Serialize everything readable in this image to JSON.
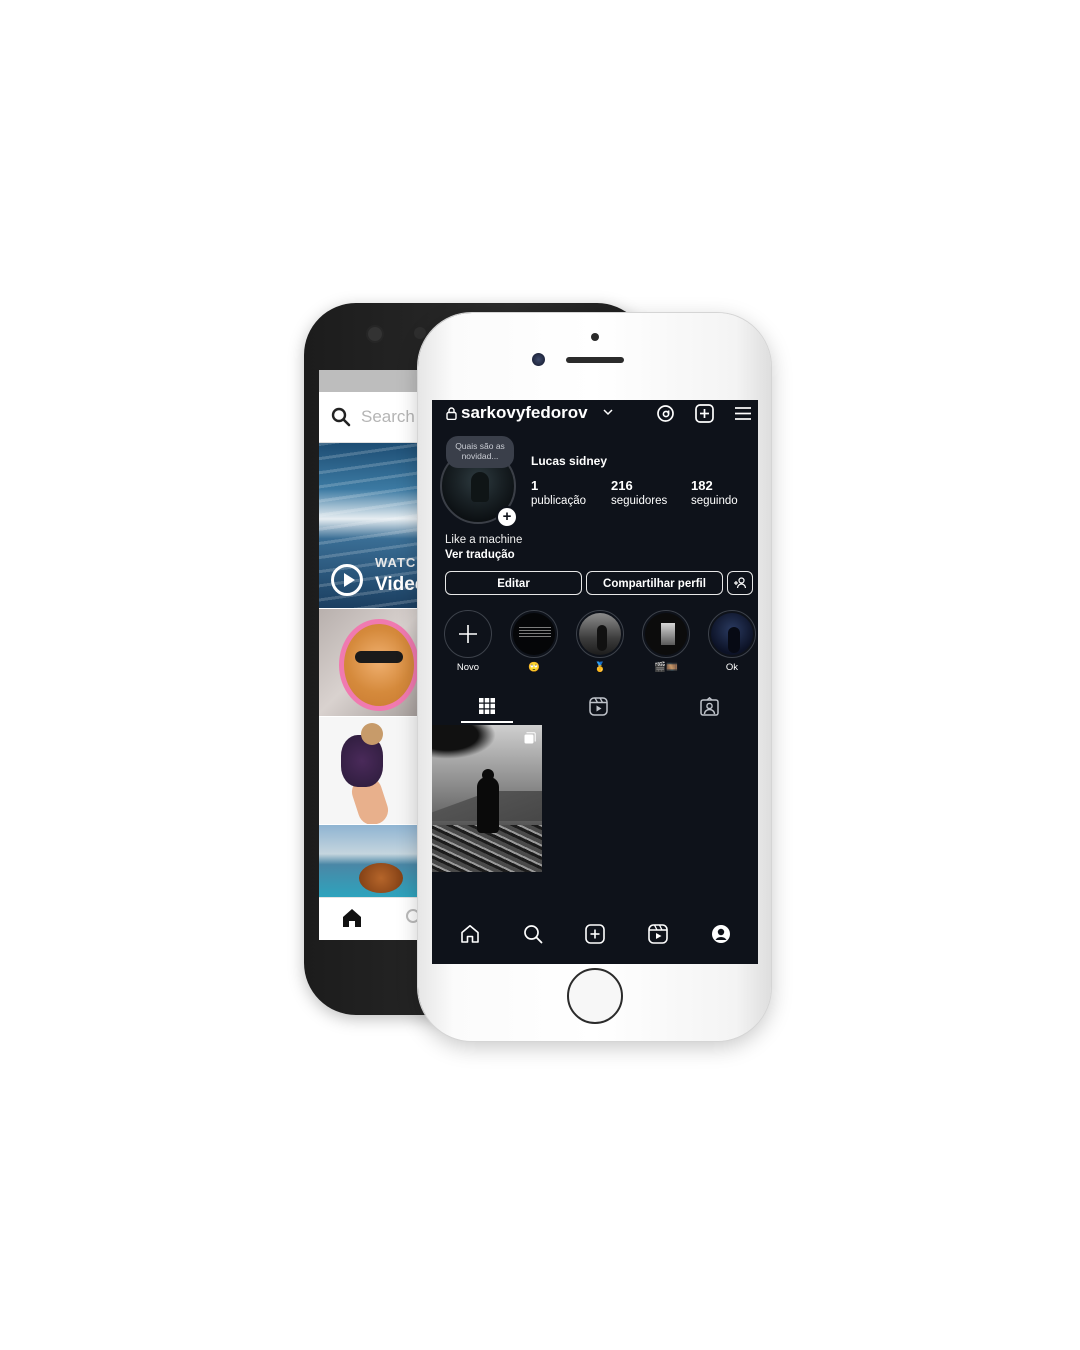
{
  "back_phone": {
    "search": {
      "placeholder": "Search"
    },
    "video_tile": {
      "label": "WATCH",
      "title": "Video"
    }
  },
  "profile": {
    "username": "sarkovyfedorov",
    "note": "Quais são as novidad...",
    "display_name": "Lucas sidney",
    "stats": [
      {
        "value": "1",
        "label": "publicação"
      },
      {
        "value": "216",
        "label": "seguidores"
      },
      {
        "value": "182",
        "label": "seguindo"
      }
    ],
    "bio": "Like a machine",
    "translate_link": "Ver tradução",
    "buttons": {
      "edit": "Editar",
      "share": "Compartilhar perfil"
    }
  },
  "highlights": [
    {
      "label": "Novo"
    },
    {
      "label": "🙄"
    },
    {
      "label": "🥇"
    },
    {
      "label": "🎬🎞️"
    },
    {
      "label": "Ok"
    }
  ],
  "icons": {
    "top": [
      "lock-icon",
      "chevron-down-icon",
      "threads-icon",
      "create-post-icon",
      "menu-icon"
    ],
    "tabs": [
      "grid-icon",
      "reels-tab-icon",
      "tagged-icon"
    ],
    "bottom_nav": [
      "home-icon",
      "search-icon",
      "create-icon",
      "reels-icon",
      "profile-icon"
    ]
  },
  "colors": {
    "screen_background": "#0e121a",
    "text": "#ffffff",
    "button_border": "#e8e8e8"
  }
}
